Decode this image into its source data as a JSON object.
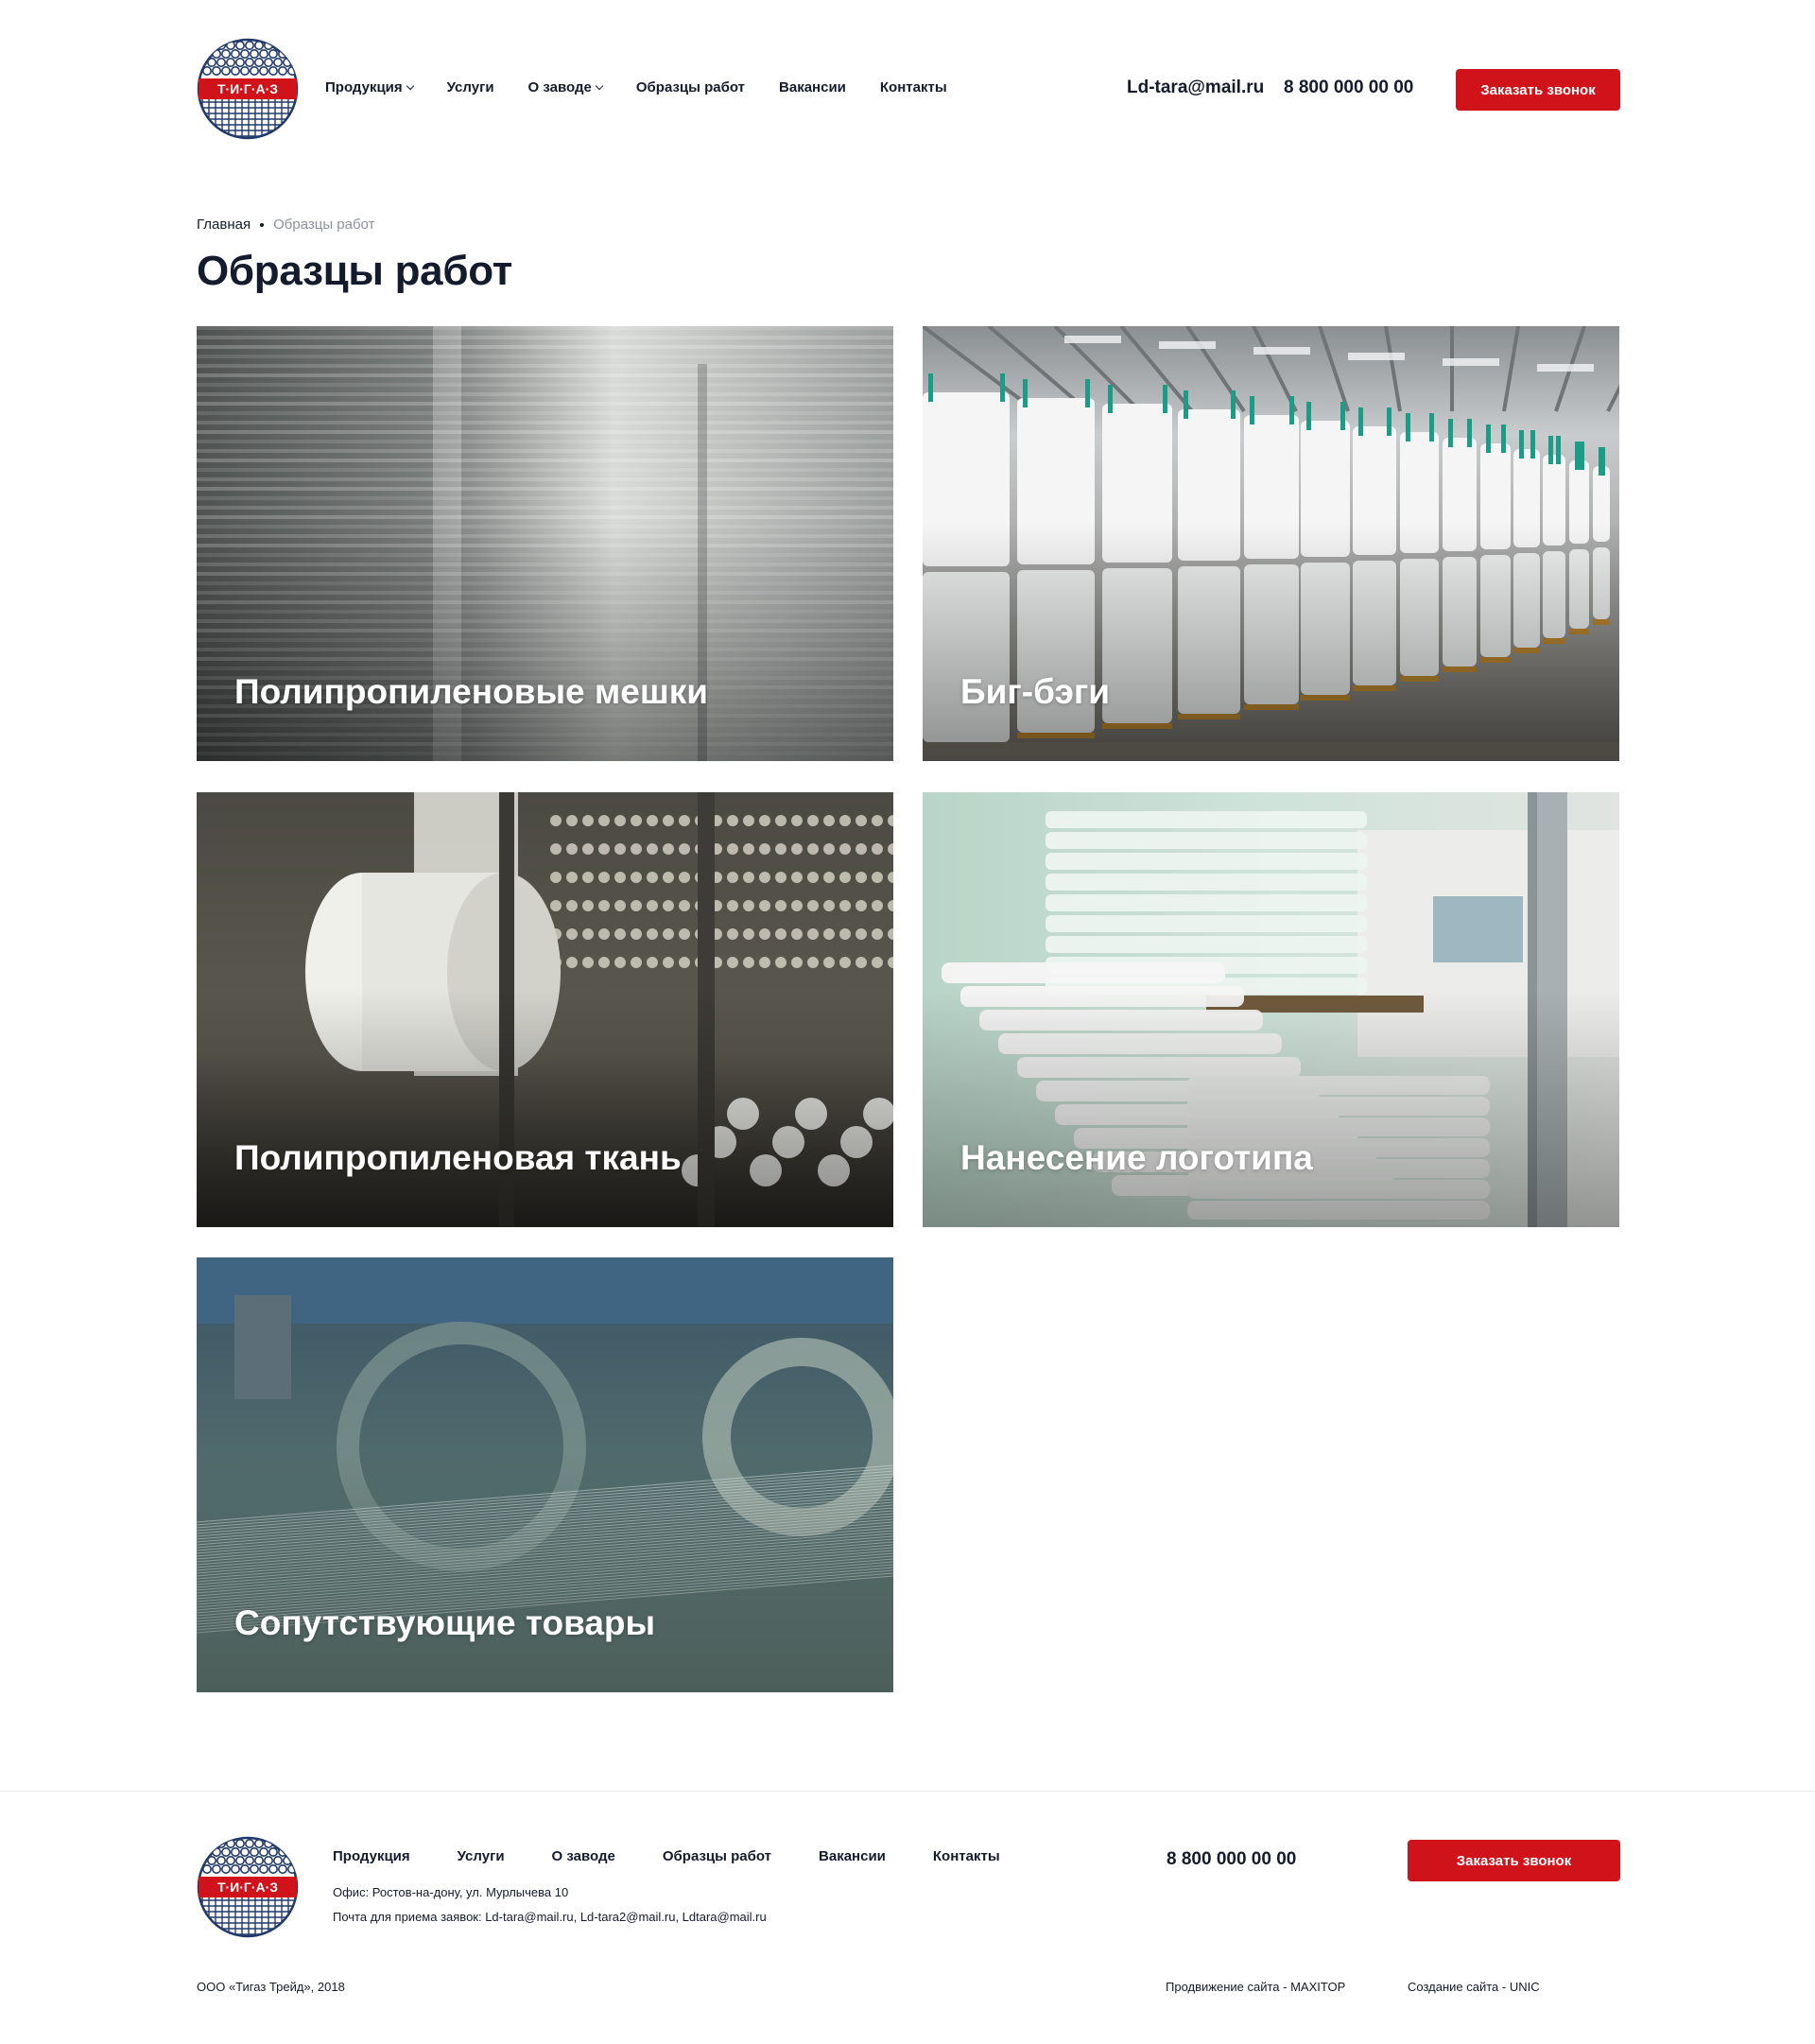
{
  "colors": {
    "accent": "#d0121b",
    "text": "#141b2d",
    "muted": "#8d929c",
    "logo_navy": "#223a6b"
  },
  "logo": {
    "text": "Т·И·Г·А·З"
  },
  "header": {
    "nav": [
      {
        "label": "Продукция",
        "dropdown": true
      },
      {
        "label": "Услуги",
        "dropdown": false
      },
      {
        "label": "О заводе",
        "dropdown": true
      },
      {
        "label": "Образцы работ",
        "dropdown": false
      },
      {
        "label": "Вакансии",
        "dropdown": false
      },
      {
        "label": "Контакты",
        "dropdown": false
      }
    ],
    "email": "Ld-tara@mail.ru",
    "phone": "8 800 000 00 00",
    "call_button": "Заказать звонок"
  },
  "breadcrumb": {
    "home": "Главная",
    "current": "Образцы работ"
  },
  "page_title": "Образцы работ",
  "cards": [
    {
      "label": "Полипропиленовые мешки"
    },
    {
      "label": "Биг-бэги"
    },
    {
      "label": "Полипропиленовая ткань"
    },
    {
      "label": "Нанесение логотипа"
    },
    {
      "label": "Сопутствующие товары"
    }
  ],
  "footer": {
    "nav": [
      "Продукция",
      "Услуги",
      "О заводе",
      "Образцы работ",
      "Вакансии",
      "Контакты"
    ],
    "office": "Офис: Ростов-на-дону, ул. Мурлычева 10",
    "mail": "Почта для приема заявок: Ld-tara@mail.ru, Ld-tara2@mail.ru, Ldtara@mail.ru",
    "phone": "8 800 000 00 00",
    "call_button": "Заказать звонок",
    "copyright": "ООО «Тигаз Трейд», 2018",
    "promotion": "Продвижение сайта - MAXITOP",
    "creation": "Создание сайта - UNIC"
  }
}
